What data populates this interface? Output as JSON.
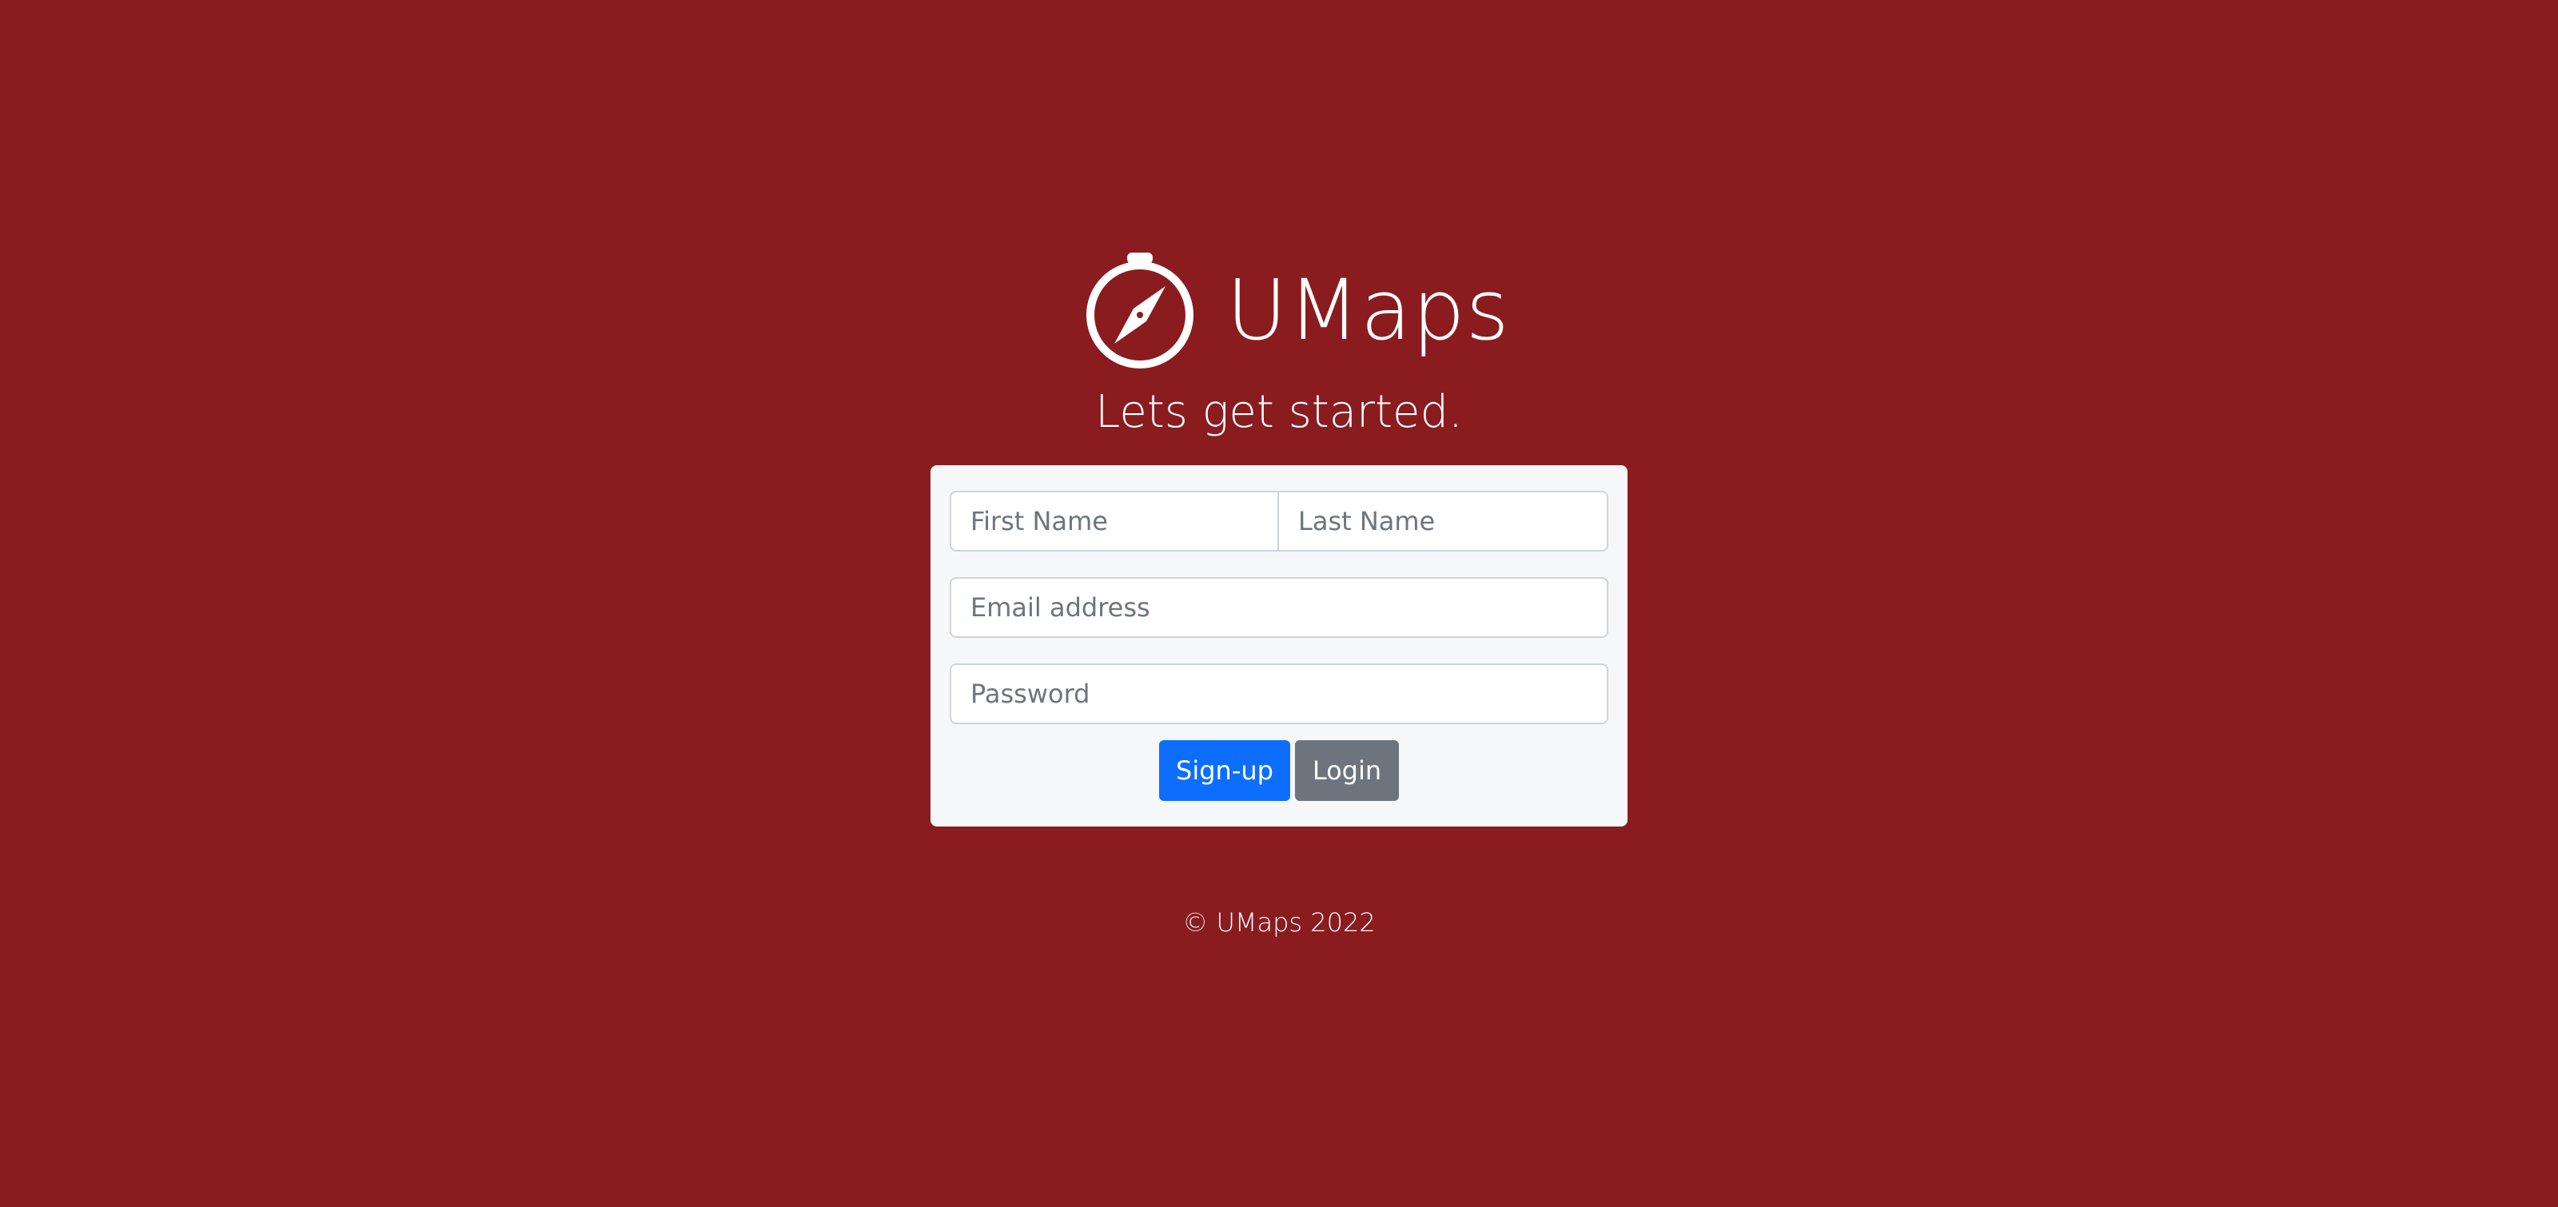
{
  "brand": {
    "title": "UMaps",
    "icon": "compass-stopwatch-icon"
  },
  "tagline": "Lets get started.",
  "form": {
    "first_name": {
      "value": "",
      "placeholder": "First Name"
    },
    "last_name": {
      "value": "",
      "placeholder": "Last Name"
    },
    "email": {
      "value": "",
      "placeholder": "Email address"
    },
    "password": {
      "value": "",
      "placeholder": "Password"
    },
    "signup_label": "Sign-up",
    "login_label": "Login"
  },
  "footer": "© UMaps 2022",
  "colors": {
    "background": "#8a1c1f",
    "card": "#f6f7f9",
    "primary_button": "#0d6efd",
    "secondary_button": "#6c757d",
    "text_light": "#ffffff"
  }
}
